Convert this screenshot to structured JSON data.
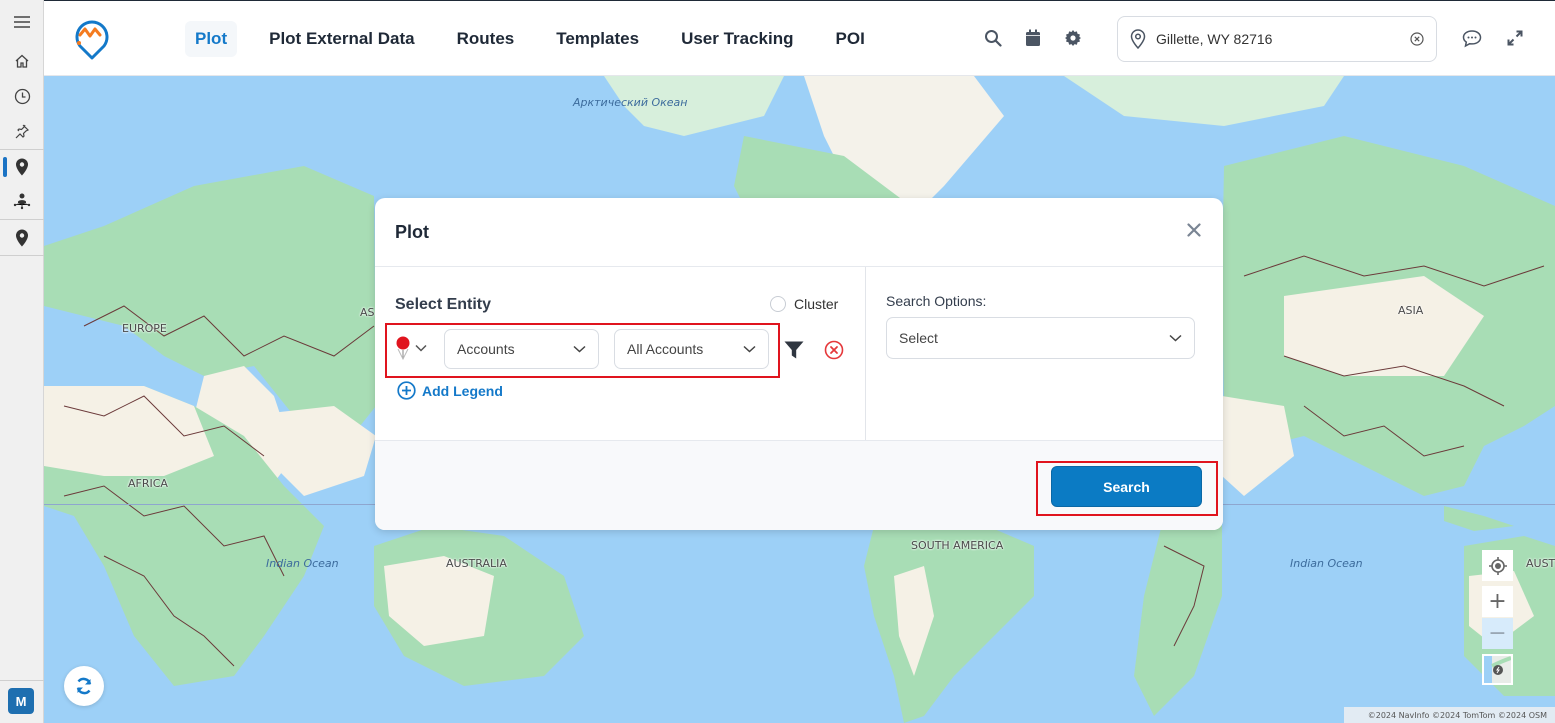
{
  "colors": {
    "accent": "#1479c9",
    "primary_button": "#0b7bc4",
    "highlight_border": "#e0141e",
    "ocean": "#9dd0f7",
    "land_green": "#a8ddb5",
    "land_cream": "#f5f1e6",
    "border_brown": "#6b3a3a",
    "pin_red": "#e0141e"
  },
  "sidebar": {
    "menu_icon": "hamburger-icon",
    "items": [
      {
        "name": "home",
        "icon": "home-icon",
        "active": false
      },
      {
        "name": "history",
        "icon": "clock-icon",
        "active": false
      },
      {
        "name": "pinned",
        "icon": "pin-icon",
        "active": false
      },
      {
        "name": "plot",
        "icon": "map-marker-icon",
        "active": true
      },
      {
        "name": "user-tracking",
        "icon": "person-network-icon",
        "active": false
      },
      {
        "name": "poi",
        "icon": "map-marker-icon",
        "active": false
      }
    ],
    "avatar_initial": "M"
  },
  "header": {
    "tabs": [
      {
        "label": "Plot",
        "active": true
      },
      {
        "label": "Plot External Data",
        "active": false
      },
      {
        "label": "Routes",
        "active": false
      },
      {
        "label": "Templates",
        "active": false
      },
      {
        "label": "User Tracking",
        "active": false
      },
      {
        "label": "POI",
        "active": false
      }
    ],
    "icons": [
      "search-icon",
      "calendar-icon",
      "gear-icon"
    ],
    "location": {
      "value": "Gillette, WY 82716",
      "icon": "location-pin-icon",
      "clear_icon": "clear-icon"
    },
    "chat_icon": "chat-icon",
    "expand_icon": "expand-icon"
  },
  "map": {
    "labels": {
      "arctic": "Арктический Океан",
      "europe": "EUROPE",
      "asia_left": "AS",
      "asia": "ASIA",
      "africa": "AFRICA",
      "indian_left": "Indian Ocean",
      "indian_right": "Indian Ocean",
      "australia": "AUSTRALIA",
      "australia_right": "AUSTRALIA",
      "south_america": "SOUTH AMERICA"
    },
    "attribution": "©2024 NavInfo  ©2024 TomTom  ©2024 OSM",
    "controls": {
      "locate": "locate-icon",
      "zoom_in": "+",
      "zoom_out": "−",
      "layers": "layer-thumbnail"
    },
    "refresh_icon": "refresh-icon"
  },
  "modal": {
    "title": "Plot",
    "close_icon": "close-icon",
    "select_entity_label": "Select Entity",
    "cluster_label": "Cluster",
    "cluster_checked": false,
    "pin_color": "#e0141e",
    "entity_dropdown": {
      "value": "Accounts"
    },
    "filter_dropdown": {
      "value": "All Accounts"
    },
    "add_legend_label": "Add Legend",
    "search_options_label": "Search Options:",
    "search_options_dropdown": {
      "value": "Select"
    },
    "search_button_label": "Search"
  }
}
